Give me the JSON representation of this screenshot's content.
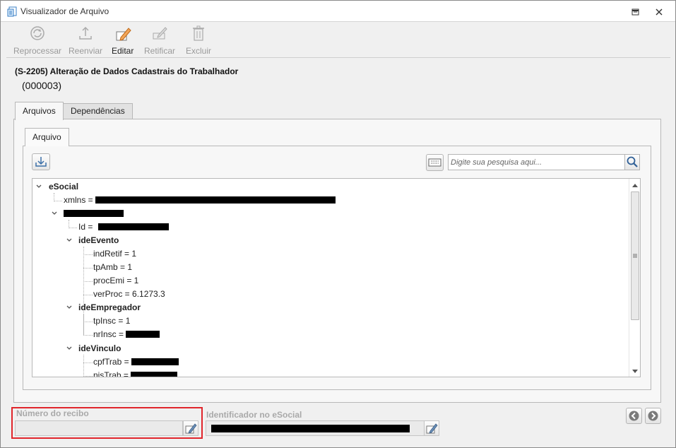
{
  "window": {
    "title": "Visualizador de Arquivo"
  },
  "toolbar": {
    "reprocessar": "Reprocessar",
    "reenviar": "Reenviar",
    "editar": "Editar",
    "retificar": "Retificar",
    "excluir": "Excluir"
  },
  "event": {
    "title": "(S-2205) Alteração de Dados Cadastrais do Trabalhador",
    "code": "(000003)"
  },
  "tabs": {
    "arquivos": "Arquivos",
    "dependencias": "Dependências",
    "arquivo": "Arquivo"
  },
  "search": {
    "placeholder": "Digite sua pesquisa aqui..."
  },
  "tree": {
    "esocial": "eSocial",
    "xmlns": "xmlns =",
    "id": "Id =",
    "ideEvento": "ideEvento",
    "indRetif": "indRetif = 1",
    "tpAmb": "tpAmb = 1",
    "procEmi": "procEmi = 1",
    "verProc": "verProc = 6.1273.3",
    "ideEmpregador": "ideEmpregador",
    "tpInsc": "tpInsc = 1",
    "nrInsc": "nrInsc =",
    "ideVinculo": "ideVinculo",
    "cpfTrab": "cpfTrab =",
    "nisTrab": "nisTrab ="
  },
  "footer": {
    "numero_recibo_label": "Número do recibo",
    "numero_recibo_value": "",
    "identificador_label": "Identificador no eSocial"
  },
  "colors": {
    "highlight": "#e0252b",
    "redaction": "#000000"
  }
}
